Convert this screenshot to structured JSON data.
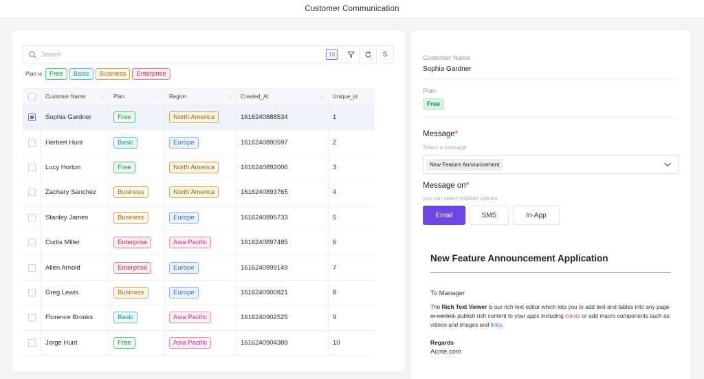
{
  "header": {
    "title": "Customer Communication"
  },
  "toolbar": {
    "search_placeholder": "Search",
    "count": "10",
    "s_label": "S"
  },
  "filter": {
    "label": "Plan is",
    "chips": [
      "Free",
      "Basic",
      "Business",
      "Enterprise"
    ]
  },
  "table": {
    "columns": [
      "Customer Name",
      "Plan",
      "Region",
      "Created_At",
      "Unique_id"
    ],
    "rows": [
      {
        "name": "Sophia Gardner",
        "plan": "Free",
        "region": "North America",
        "created_at": "1616240888534",
        "id": "1",
        "selected": true
      },
      {
        "name": "Herbert Hunt",
        "plan": "Basic",
        "region": "Europe",
        "created_at": "1616240890597",
        "id": "2",
        "selected": false
      },
      {
        "name": "Lucy Horton",
        "plan": "Free",
        "region": "North America",
        "created_at": "1616240892006",
        "id": "3",
        "selected": false
      },
      {
        "name": "Zachary Sanchez",
        "plan": "Business",
        "region": "North America",
        "created_at": "1616240893765",
        "id": "4",
        "selected": false
      },
      {
        "name": "Stanley James",
        "plan": "Business",
        "region": "Europe",
        "created_at": "1616240895733",
        "id": "5",
        "selected": false
      },
      {
        "name": "Curtis Miller",
        "plan": "Enterprise",
        "region": "Asia Pacific",
        "created_at": "1616240897485",
        "id": "6",
        "selected": false
      },
      {
        "name": "Allen Arnold",
        "plan": "Enterprise",
        "region": "Europe",
        "created_at": "1616240899149",
        "id": "7",
        "selected": false
      },
      {
        "name": "Greg Lewis",
        "plan": "Business",
        "region": "Europe",
        "created_at": "1616240900821",
        "id": "8",
        "selected": false
      },
      {
        "name": "Florence Brooks",
        "plan": "Basic",
        "region": "Asia Pacific",
        "created_at": "1616240902525",
        "id": "9",
        "selected": false
      },
      {
        "name": "Jorge Hunt",
        "plan": "Free",
        "region": "Asia Pacific",
        "created_at": "1616240904389",
        "id": "10",
        "selected": false
      }
    ]
  },
  "detail": {
    "customer_name_label": "Customer Name",
    "customer_name": "Sophia Gardner",
    "plan_label": "Plan",
    "plan": "Free",
    "message_label": "Message",
    "message_required": "*",
    "message_hint": "Select a message",
    "message_selected": "New Feature Announcement",
    "message_on_label": "Message on",
    "message_on_required": "*",
    "message_on_hint": "you can select multiple options",
    "channels": [
      {
        "label": "Email",
        "active": true
      },
      {
        "label": "SMS",
        "active": false
      },
      {
        "label": "In-App",
        "active": false
      }
    ]
  },
  "document": {
    "title": "New Feature Announcement Application",
    "to": "To Manager",
    "body": {
      "p1": "The ",
      "bold": "Rich Text Viewer",
      "p2": " is our rich text editor which lets you to add text and tables into any page ",
      "strike": "or control,",
      "p3": " publish rich content to your ",
      "italic": "apps",
      "p4": " including ",
      "colors": "colors",
      "p5": " or add macro components such as videos and images and ",
      "links": "links",
      "p6": "."
    },
    "regards": "Regards",
    "company": "Acme.com"
  },
  "colors": {
    "accent": "#6b46e0",
    "selected_row": "#eef2fa",
    "required": "#e0273b"
  }
}
